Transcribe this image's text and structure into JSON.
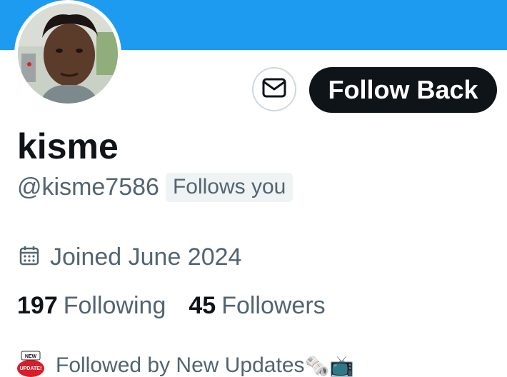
{
  "colors": {
    "banner": "#1d9bf0",
    "primary_text": "#0f1419",
    "secondary_text": "#536471",
    "follow_button_bg": "#0f1419",
    "follow_button_text": "#ffffff"
  },
  "profile": {
    "display_name": "kisme",
    "handle": "@kisme7586",
    "follows_you_badge": "Follows you",
    "joined": "Joined June 2024",
    "following_count": "197",
    "following_label": "Following",
    "followers_count": "45",
    "followers_label": "Followers",
    "followed_by": "Followed by New Updates",
    "followed_by_emojis": "🗞️📺",
    "followed_by_avatar_text_line1": "NEW",
    "followed_by_avatar_text_line2": "UPDATE!"
  },
  "actions": {
    "message_icon": "envelope-icon",
    "follow_back_label": "Follow Back"
  },
  "icons": {
    "joined": "calendar-icon"
  }
}
